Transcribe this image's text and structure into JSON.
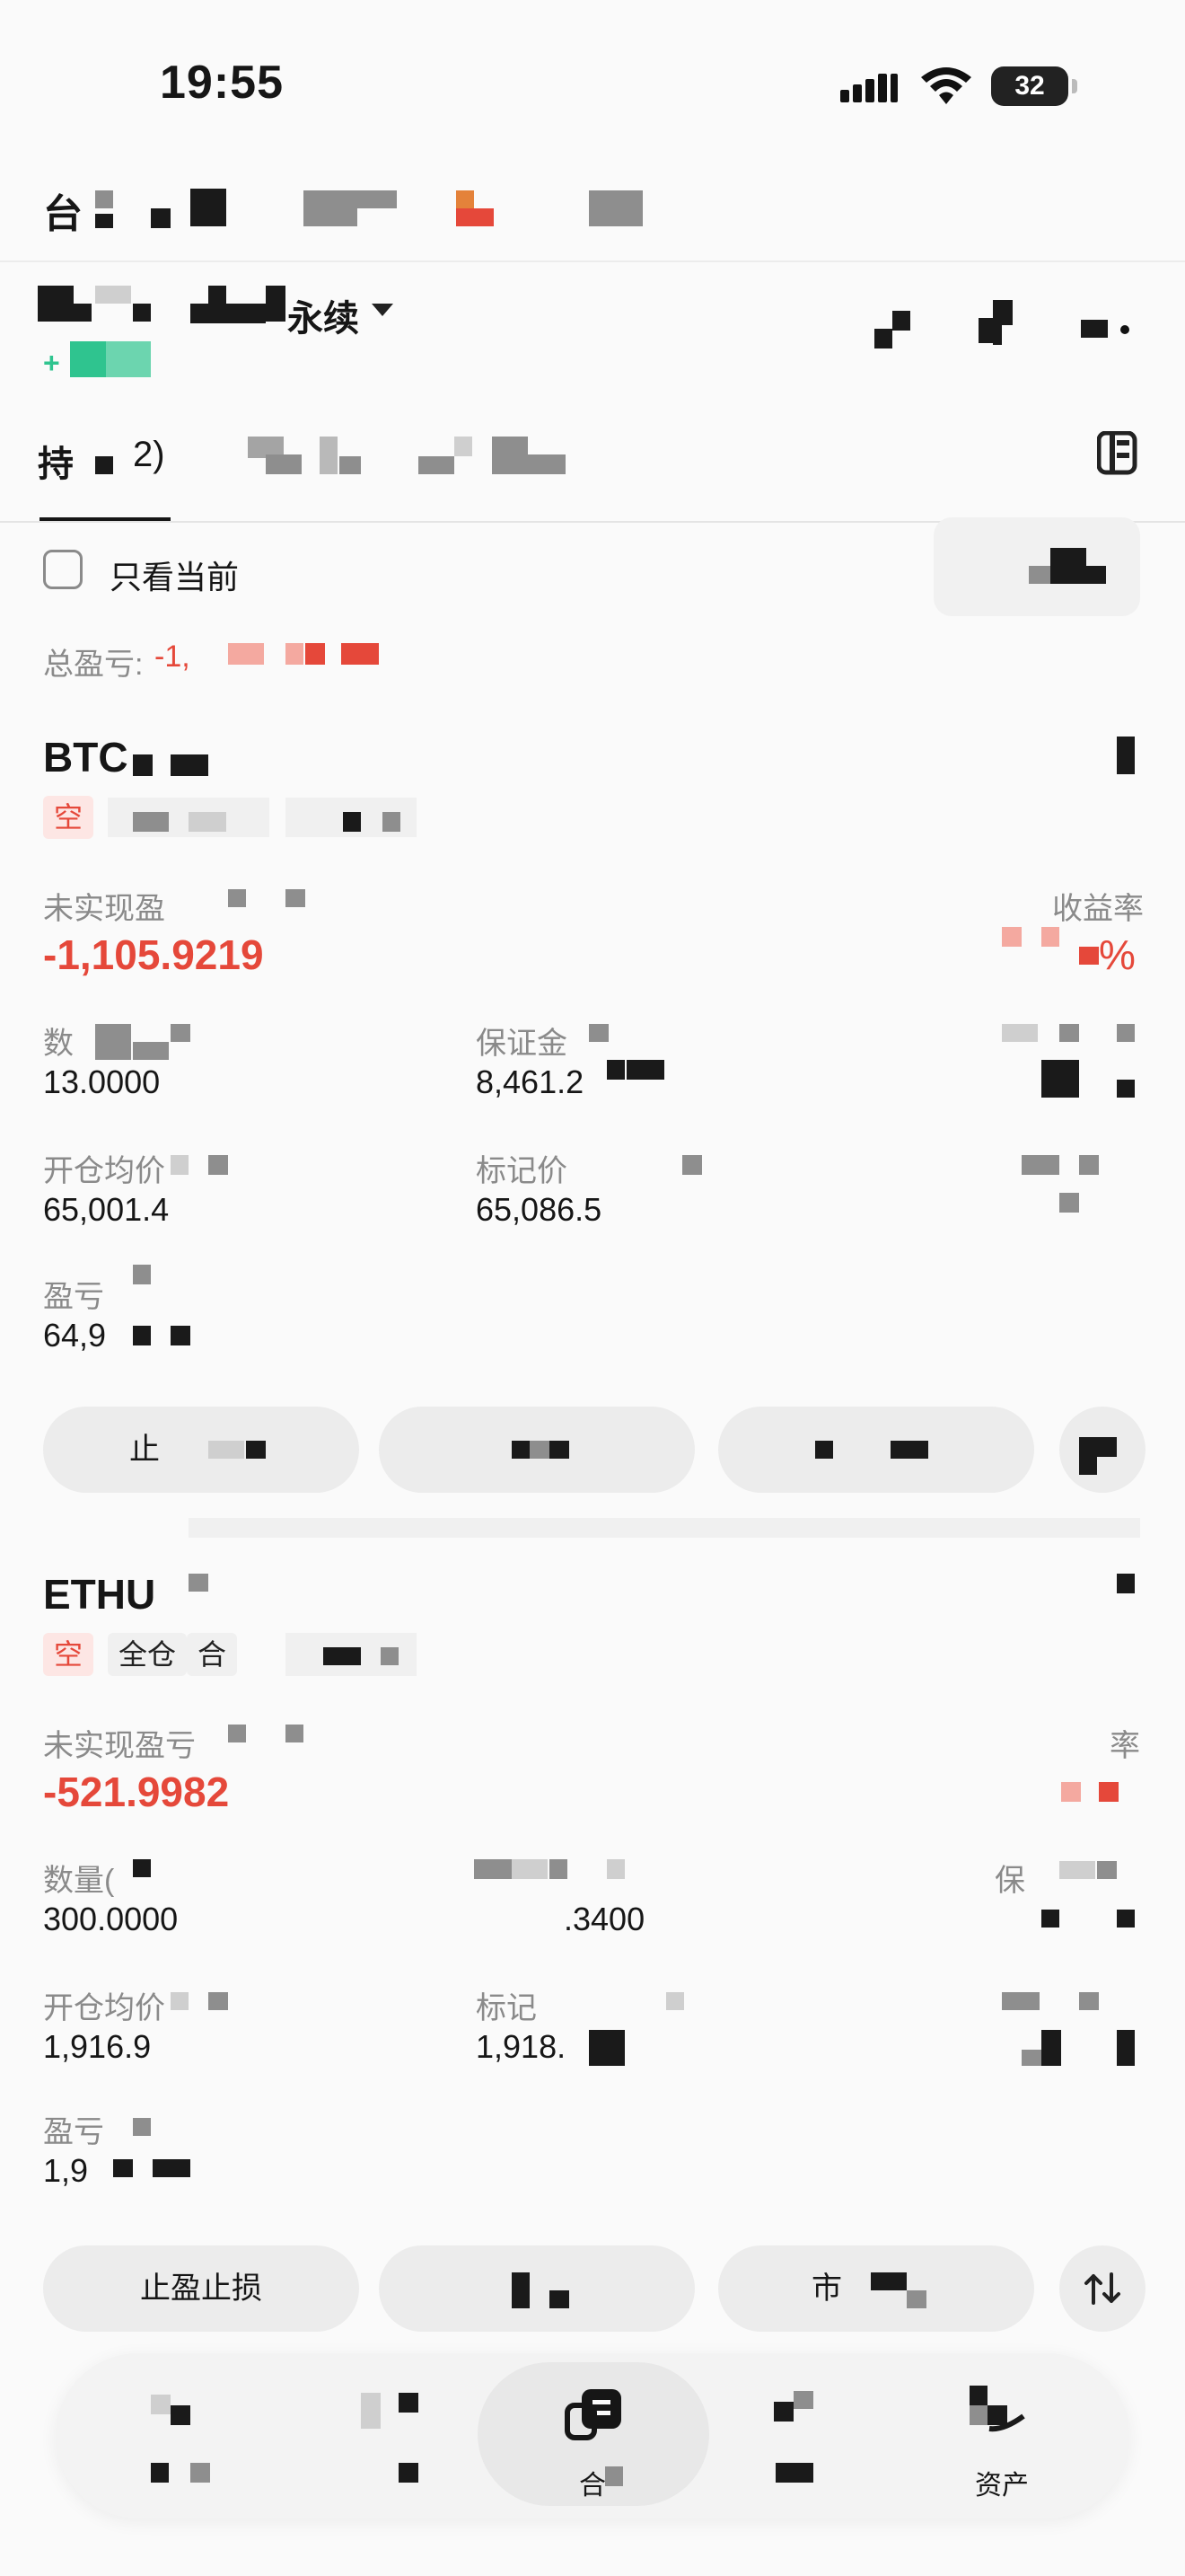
{
  "status_bar": {
    "time": "19:55",
    "battery": "32"
  },
  "header": {
    "title_partial": "台",
    "contract_suffix": "永续",
    "change_prefix": "+"
  },
  "tabs": {
    "active_partial": "持",
    "active_count": "2)"
  },
  "filter": {
    "only_current_label": "只看当前"
  },
  "summary": {
    "total_pnl_label": "总盈亏:",
    "total_pnl_value": "-1,"
  },
  "positions": [
    {
      "symbol": "BTC",
      "tag_side": "空",
      "unrealized_label": "未实现盈",
      "unrealized_value": "-1,105.9219",
      "return_label": "收益率",
      "return_value_suffix": "%",
      "qty_label": "数",
      "qty_value": "13.0000",
      "margin_label": "保证金",
      "margin_value": "8,461.2",
      "open_price_label": "开仓均价",
      "open_price_value": "65,001.4",
      "mark_price_label": "标记价",
      "mark_price_value": "65,086.5",
      "breakeven_label": "盈亏",
      "breakeven_value": "64,9",
      "btn_1": "止"
    },
    {
      "symbol": "ETHU",
      "tag_side": "空",
      "tag_mode": "全仓",
      "tag_mode2": "合",
      "unrealized_label": "未实现盈亏",
      "unrealized_value": "-521.9982",
      "return_label": "率",
      "qty_label": "数量(",
      "qty_value": "300.0000",
      "margin_value": ".3400",
      "margin_label_partial": "保",
      "open_price_label": "开仓均价",
      "open_price_value": "1,916.9",
      "mark_price_label": "标记",
      "mark_price_value": "1,918.",
      "breakeven_label": "盈亏",
      "breakeven_value": "1,9",
      "btn_1": "止盈止损",
      "btn_3": "市"
    }
  ],
  "bottom_nav": {
    "positions_label": "合",
    "assets_label": "资产"
  },
  "icons": [
    "wifi-icon",
    "cellular-icon",
    "battery-icon",
    "dropdown-caret-icon",
    "chart-icon",
    "candle-icon",
    "more-icon",
    "history-icon",
    "sort-icon",
    "orders-icon",
    "assets-icon"
  ]
}
